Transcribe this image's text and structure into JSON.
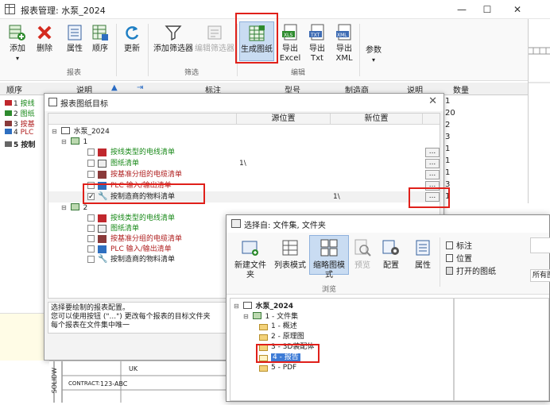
{
  "window": {
    "title": "报表管理: 水泵_2024",
    "minimize": "—",
    "maximize": "☐",
    "close": "✕"
  },
  "ribbon": {
    "buttons": [
      {
        "label": "添加"
      },
      {
        "label": "删除"
      },
      {
        "label": "属性"
      },
      {
        "label": "顺序"
      },
      {
        "label": "更新"
      },
      {
        "label": "添加筛选器"
      },
      {
        "label": "编辑筛选器"
      },
      {
        "label": "生成图纸"
      },
      {
        "label": "导出Excel"
      },
      {
        "label": "导出Txt"
      },
      {
        "label": "导出XML"
      },
      {
        "label": "参数"
      }
    ],
    "export_line1": "导出",
    "export_excel": "Excel",
    "export_txt": "Txt",
    "export_xml": "XML",
    "groups": {
      "report": "报表",
      "filter": "筛选",
      "edit": "编辑"
    }
  },
  "main_table": {
    "headers": {
      "order": "顺序",
      "desc": "说明",
      "note": "标注",
      "model": "型号",
      "maker": "制造商",
      "explain": "说明",
      "qty": "数量"
    },
    "left_rows": [
      {
        "num": "1",
        "text": "按线"
      },
      {
        "num": "2",
        "text": "图纸"
      },
      {
        "num": "3",
        "text": "按基"
      },
      {
        "num": "4",
        "text": "PLC"
      },
      {
        "num": "5",
        "text": "按制"
      }
    ],
    "quantities": [
      "1",
      "20",
      "2",
      "3",
      "1",
      "1",
      "1",
      "3",
      "1"
    ]
  },
  "dialog1": {
    "title": "报表图纸目标",
    "close": "✕",
    "columns": {
      "source": "源位置",
      "new": "新位置"
    },
    "root": "水泵_2024",
    "group1": {
      "label": "1",
      "items": [
        {
          "label": "按线类型的电线清单",
          "source": "",
          "new": "",
          "checked": false
        },
        {
          "label": "图纸清单",
          "source": "1\\",
          "new": "",
          "checked": false
        },
        {
          "label": "按基准分组的电缆清单",
          "source": "",
          "new": "",
          "checked": false
        },
        {
          "label": "PLC 输入/输出清单",
          "source": "",
          "new": "",
          "checked": false
        },
        {
          "label": "按制造商的物料清单",
          "source": "",
          "new": "1\\",
          "checked": true
        }
      ]
    },
    "group2": {
      "label": "2",
      "items": [
        {
          "label": "按线类型的电线清单"
        },
        {
          "label": "图纸清单"
        },
        {
          "label": "按基准分组的电缆清单"
        },
        {
          "label": "PLC 输入/输出清单"
        },
        {
          "label": "按制造商的物料清单"
        }
      ]
    },
    "dots": "...",
    "description": [
      "选择要绘制的报表配置。",
      "您可以使用按钮 (\"...\") 更改每个报表的目标文件夹",
      "每个报表在文件集中唯一"
    ]
  },
  "dialog2": {
    "title": "选择自: 文件集, 文件夹",
    "buttons": [
      {
        "label": "新建文件夹"
      },
      {
        "label": "列表模式"
      },
      {
        "label": "缩略图模式"
      },
      {
        "label": "预览"
      },
      {
        "label": "配置"
      },
      {
        "label": "属性"
      }
    ],
    "side_items": [
      {
        "label": "标注"
      },
      {
        "label": "位置"
      },
      {
        "label": "打开的图纸"
      }
    ],
    "browse_group": "浏览",
    "right_field": "所有图",
    "tree": {
      "root": "水泵_2024",
      "set": "1 - 文件集",
      "folders": [
        "1 - 概述",
        "2 - 原理图",
        "3 - 3D装配体",
        "4 - 报告",
        "5 - PDF"
      ]
    }
  },
  "drawing": {
    "contract_label": "CONTRACT:",
    "contract_value": "123-ABC",
    "side_text": "SOLIDW",
    "mark": "UK"
  },
  "colors": {
    "highlight": "#e0201a",
    "accent": "#2b6cc4",
    "selected": "#3d7bd6"
  }
}
